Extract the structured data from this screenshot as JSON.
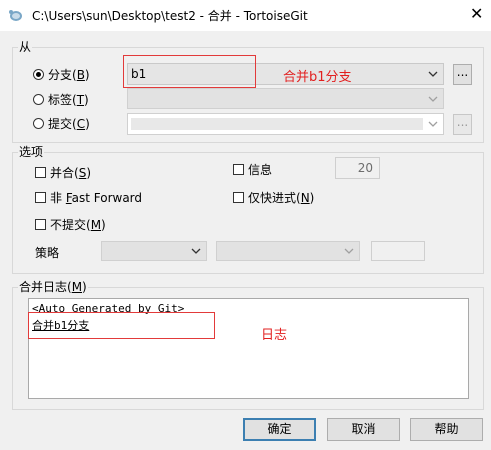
{
  "window": {
    "title": "C:\\Users\\sun\\Desktop\\test2 - 合并 - TortoiseGit",
    "close_glyph": "✕",
    "icon": "tortoisegit-icon"
  },
  "from_group": {
    "label": "从",
    "branch": {
      "label_pre": "分支(",
      "hotkey": "B",
      "label_post": ")",
      "value": "b1",
      "selected": true
    },
    "tag": {
      "label_pre": "标签(",
      "hotkey": "T",
      "label_post": ")",
      "value": ""
    },
    "commit": {
      "label_pre": "提交(",
      "hotkey": "C",
      "label_post": ")",
      "value": ""
    },
    "browse_label": "..."
  },
  "options_group": {
    "label": "选项",
    "squash": {
      "label_pre": "并合(",
      "hotkey": "S",
      "label_post": ")",
      "checked": false
    },
    "message_count": {
      "label": "信息",
      "checked": false,
      "value": "20"
    },
    "no_ff": {
      "label_pre": "非 ",
      "hotkey": "F",
      "label_post": "ast Forward",
      "checked": false
    },
    "ff_only": {
      "label_pre": "仅快进式(",
      "hotkey": "N",
      "label_post": ")",
      "checked": false
    },
    "no_commit": {
      "label_pre": "不提交(",
      "hotkey": "M",
      "label_post": ")",
      "checked": false
    },
    "strategy": {
      "label": "策略",
      "value": "",
      "option_value": "",
      "extra_value": ""
    }
  },
  "log_group": {
    "label_pre": "合并日志(",
    "hotkey": "M",
    "label_post": ")",
    "lines": [
      "<Auto Generated by Git>",
      "合并b1分支"
    ]
  },
  "annotations": {
    "branch_note": "合并b1分支",
    "log_note": "日志",
    "color": "#e21f1f"
  },
  "buttons": {
    "ok": "确定",
    "cancel": "取消",
    "help": "帮助"
  }
}
